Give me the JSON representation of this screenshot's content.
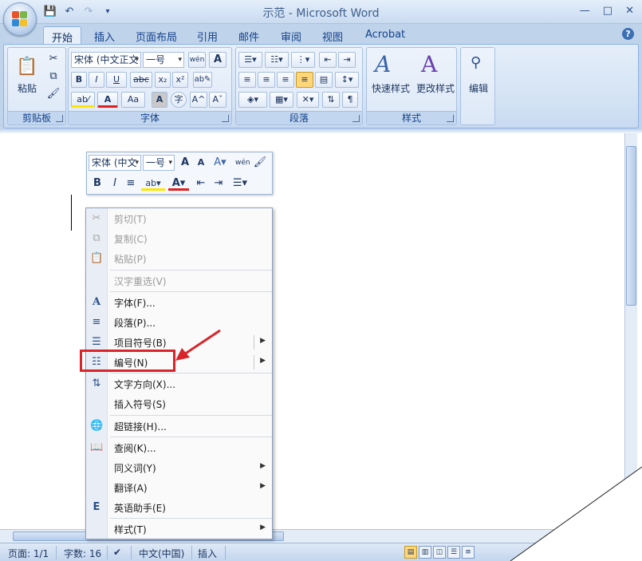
{
  "window": {
    "title": "示范 - Microsoft Word",
    "minimize": "—",
    "maximize": "□",
    "close": "✕"
  },
  "qat": {
    "save": "💾",
    "undo": "↶",
    "redo": "↷",
    "customize": "▾"
  },
  "tabs": [
    "开始",
    "插入",
    "页面布局",
    "引用",
    "邮件",
    "审阅",
    "视图",
    "Acrobat"
  ],
  "active_tab": "开始",
  "help": "?",
  "ribbon": {
    "clipboard": {
      "label": "剪贴板",
      "paste": "粘贴"
    },
    "font": {
      "label": "字体",
      "font_name": "宋体 (中文正文",
      "font_size": "一号",
      "bold": "B",
      "italic": "I",
      "underline": "U",
      "strikethrough": "abc",
      "subscript": "x₂",
      "superscript": "x²",
      "case": "Aa",
      "grow": "A^",
      "shrink": "Aˇ",
      "phonetic": "wén",
      "border_char": "A",
      "char_shade": "A",
      "enclose": "字"
    },
    "paragraph": {
      "label": "段落"
    },
    "styles": {
      "label": "样式",
      "quick_styles": "快速样式",
      "change_styles": "更改样式"
    },
    "editing": {
      "label": "编辑"
    }
  },
  "mini_toolbar": {
    "font_name": "宋体 (中文",
    "font_size": "一号",
    "bold": "B",
    "italic": "I"
  },
  "context_menu": [
    {
      "label": "剪切(T)",
      "icon": "scissors-icon",
      "glyph": "✂",
      "disabled": true
    },
    {
      "label": "复制(C)",
      "icon": "copy-icon",
      "glyph": "⧉",
      "disabled": true
    },
    {
      "label": "粘贴(P)",
      "icon": "paste-icon",
      "glyph": "📋",
      "disabled": true
    },
    {
      "label": "汉字重选(V)",
      "icon": "",
      "glyph": "",
      "disabled": true
    },
    {
      "label": "字体(F)...",
      "icon": "font-icon",
      "glyph": "A",
      "disabled": false
    },
    {
      "label": "段落(P)...",
      "icon": "paragraph-icon",
      "glyph": "≡",
      "disabled": false
    },
    {
      "label": "项目符号(B)",
      "icon": "bullets-icon",
      "glyph": "☰",
      "disabled": false,
      "submenu": true
    },
    {
      "label": "编号(N)",
      "icon": "numbering-icon",
      "glyph": "☷",
      "disabled": false,
      "submenu": true
    },
    {
      "label": "文字方向(X)...",
      "icon": "text-direction-icon",
      "glyph": "⇅",
      "disabled": false
    },
    {
      "label": "插入符号(S)",
      "icon": "",
      "glyph": "",
      "disabled": false
    },
    {
      "label": "超链接(H)...",
      "icon": "hyperlink-icon",
      "glyph": "🌐",
      "disabled": false
    },
    {
      "label": "查阅(K)...",
      "icon": "lookup-icon",
      "glyph": "📖",
      "disabled": false
    },
    {
      "label": "同义词(Y)",
      "icon": "",
      "glyph": "",
      "disabled": false,
      "submenu": true
    },
    {
      "label": "翻译(A)",
      "icon": "",
      "glyph": "",
      "disabled": false,
      "submenu": true
    },
    {
      "label": "英语助手(E)",
      "icon": "english-assistant-icon",
      "glyph": "E",
      "disabled": false
    },
    {
      "label": "样式(T)",
      "icon": "",
      "glyph": "",
      "disabled": false,
      "submenu": true
    }
  ],
  "status_bar": {
    "page": "页面: 1/1",
    "words": "字数: 16",
    "language": "中文(中国)",
    "mode": "插入"
  },
  "colors": {
    "highlight": "#d9252a",
    "accent": "#15428b"
  }
}
